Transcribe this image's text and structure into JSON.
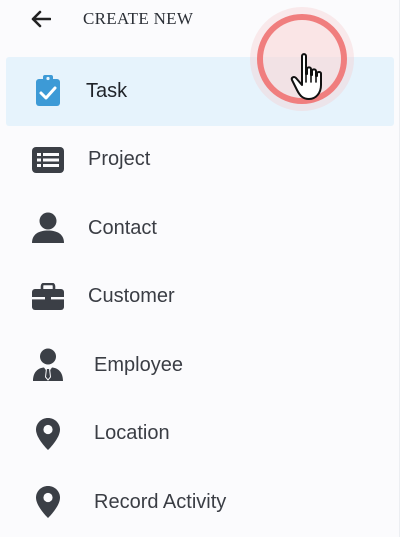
{
  "header": {
    "title": "CREATE NEW",
    "back_icon": "arrow-left-icon"
  },
  "menu": {
    "items": [
      {
        "label": "Task",
        "icon": "clipboard-check-icon",
        "active": true
      },
      {
        "label": "Project",
        "icon": "list-icon",
        "active": false
      },
      {
        "label": "Contact",
        "icon": "user-icon",
        "active": false
      },
      {
        "label": "Customer",
        "icon": "briefcase-icon",
        "active": false
      },
      {
        "label": "Employee",
        "icon": "user-tie-icon",
        "active": false
      },
      {
        "label": "Location",
        "icon": "map-marker-icon",
        "active": false
      },
      {
        "label": "Record Activity",
        "icon": "map-marker-icon",
        "active": false
      }
    ]
  },
  "colors": {
    "accent": "#3d9ad6",
    "active_bg": "#e6f3fc",
    "icon": "#3b3f46",
    "click_ring": "#f07e7e"
  }
}
